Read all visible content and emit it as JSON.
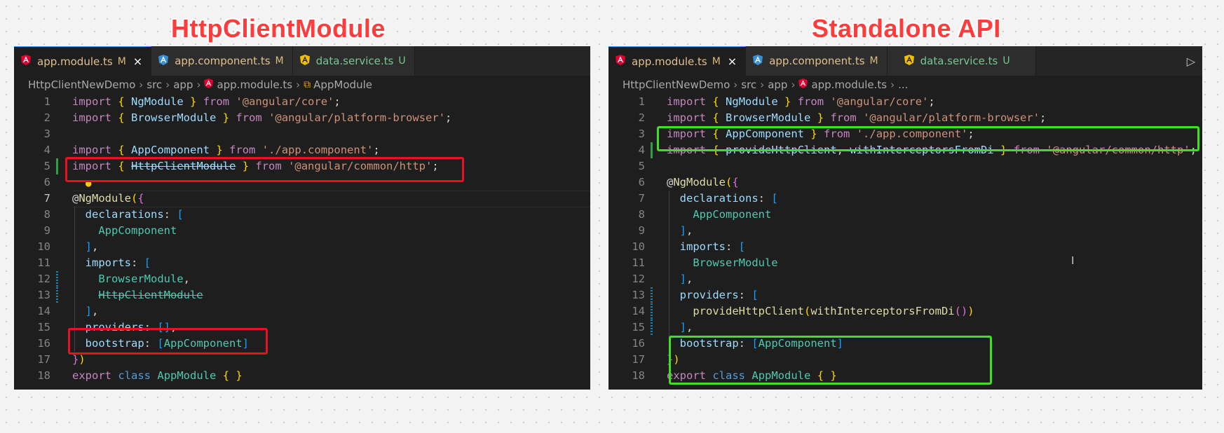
{
  "titles": {
    "left": "HttpClientModule",
    "right": "Standalone API"
  },
  "colors": {
    "title": "#ff3b3b",
    "removed_box": "#e81123",
    "added_box": "#3fe020",
    "editor_bg": "#1e1e1e"
  },
  "left": {
    "tabs": [
      {
        "label": "app.module.ts",
        "status": "M",
        "close": "×"
      },
      {
        "label": "app.component.ts",
        "status": "M"
      },
      {
        "label": "data.service.ts",
        "status": "U"
      }
    ],
    "breadcrumb": {
      "project": "HttpClientNewDemo",
      "folder1": "src",
      "folder2": "app",
      "file": "app.module.ts",
      "symbol": "AppModule"
    },
    "lines": [
      "1",
      "2",
      "3",
      "4",
      "5",
      "6",
      "7",
      "8",
      "9",
      "10",
      "11",
      "12",
      "13",
      "14",
      "15",
      "16",
      "17",
      "18"
    ],
    "code": {
      "import": "import",
      "from": "from",
      "export": "export",
      "class": "class",
      "ngmodule": "NgModule",
      "browsermodule": "BrowserModule",
      "appcomponent": "AppComponent",
      "httpclientmodule": "HttpClientModule",
      "appmodule": "AppModule",
      "s_core": "'@angular/core'",
      "s_browser": "'@angular/platform-browser'",
      "s_comp": "'./app.component'",
      "s_http": "'@angular/common/http'",
      "at": "@",
      "declarations": "declarations",
      "imports": "imports",
      "providers": "providers",
      "bootstrap": "bootstrap"
    }
  },
  "right": {
    "tabs": [
      {
        "label": "app.module.ts",
        "status": "M",
        "close": "×"
      },
      {
        "label": "app.component.ts",
        "status": "M"
      },
      {
        "label": "data.service.ts",
        "status": "U"
      }
    ],
    "run_icon": "▷",
    "breadcrumb": {
      "project": "HttpClientNewDemo",
      "folder1": "src",
      "folder2": "app",
      "file": "app.module.ts",
      "more": "..."
    },
    "lines": [
      "1",
      "2",
      "3",
      "4",
      "5",
      "6",
      "7",
      "8",
      "9",
      "10",
      "11",
      "12",
      "13",
      "14",
      "15",
      "16",
      "17",
      "18"
    ],
    "code": {
      "import": "import",
      "from": "from",
      "export": "export",
      "class": "class",
      "ngmodule": "NgModule",
      "browsermodule": "BrowserModule",
      "appcomponent": "AppComponent",
      "providehttpclient": "provideHttpClient",
      "withinterceptors": "withInterceptorsFromDi",
      "appmodule": "AppModule",
      "s_core": "'@angular/core'",
      "s_browser": "'@angular/platform-browser'",
      "s_comp": "'./app.component'",
      "s_http": "'@angular/common/http'",
      "at": "@",
      "declarations": "declarations",
      "imports": "imports",
      "providers": "providers",
      "bootstrap": "bootstrap"
    }
  },
  "icons": {
    "angular": "angular-icon",
    "close": "close-icon",
    "symbol": "symbol-class-icon",
    "lightbulb": "lightbulb-icon",
    "run": "run-icon"
  }
}
